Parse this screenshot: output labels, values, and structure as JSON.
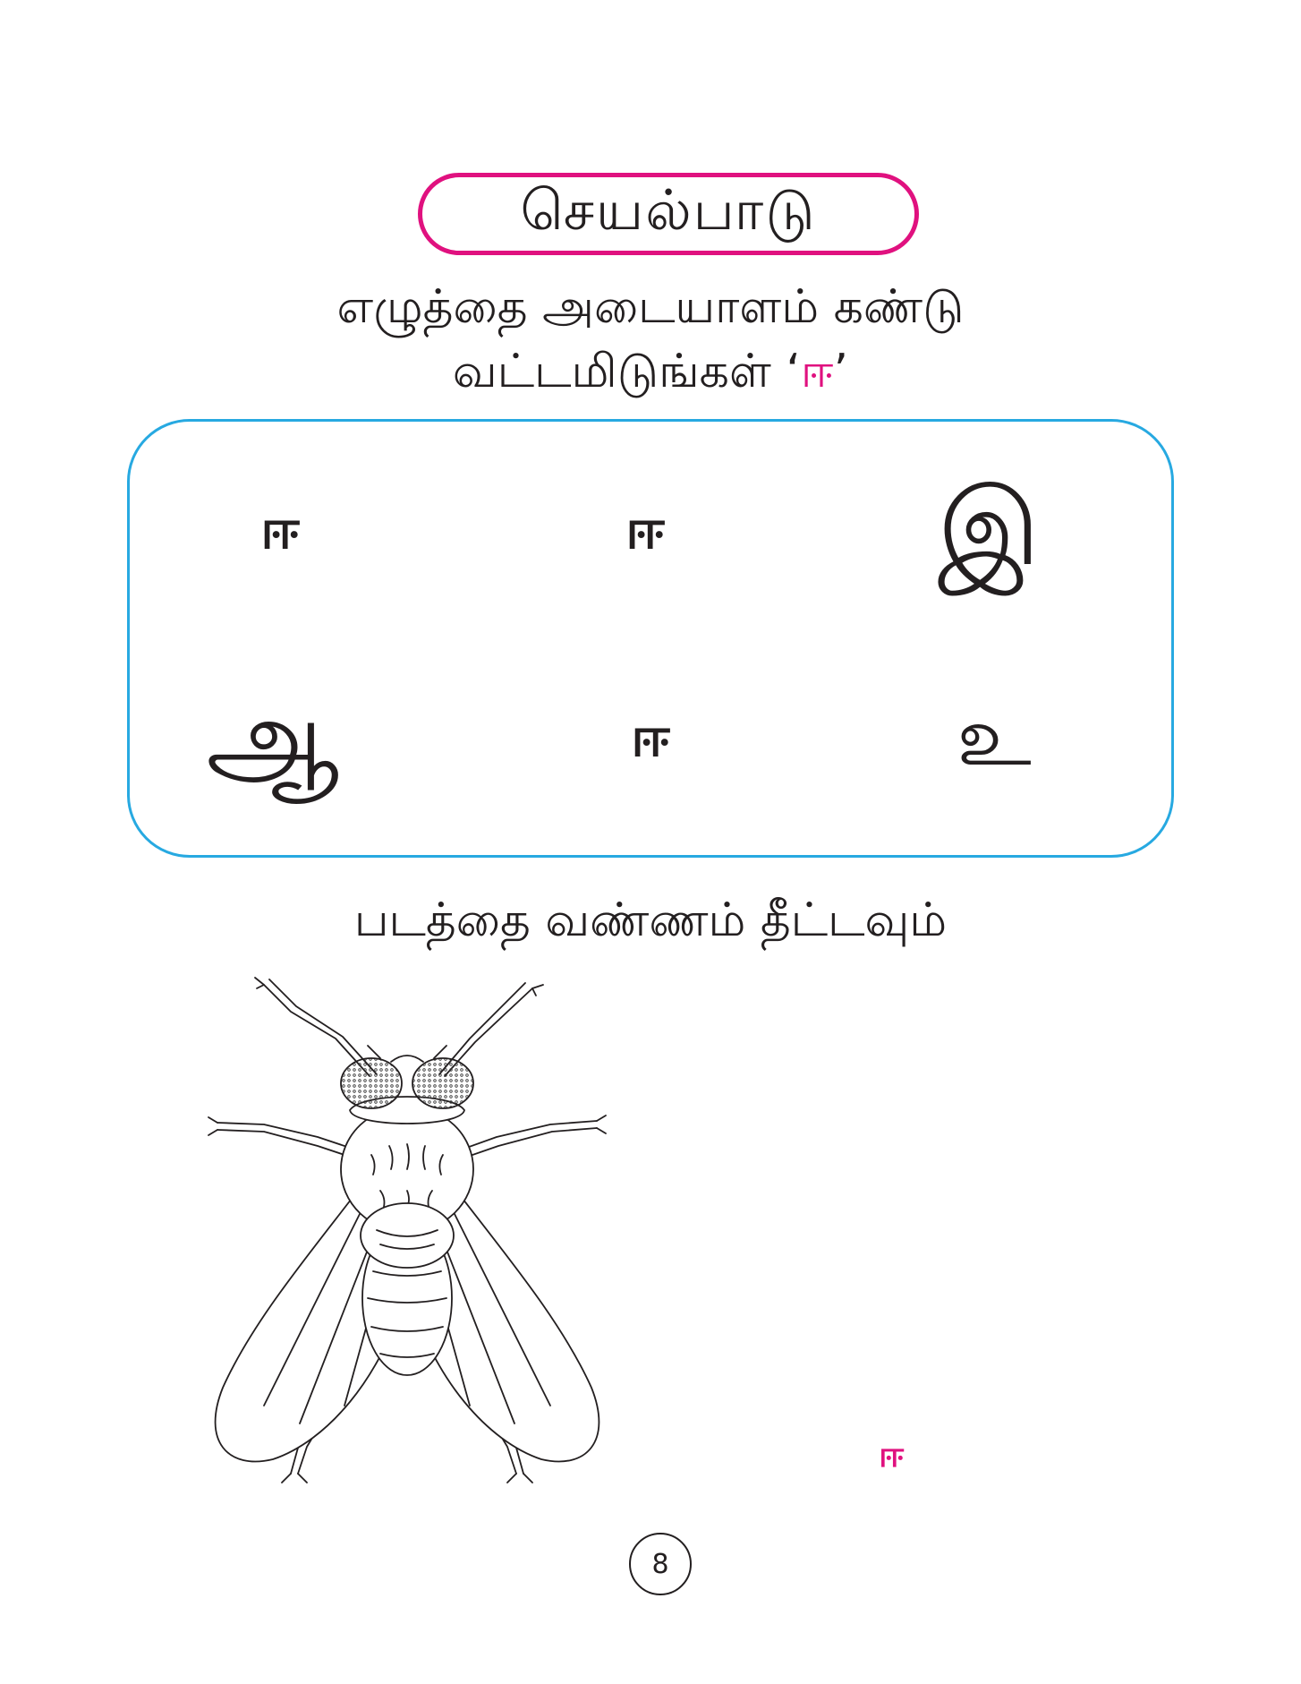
{
  "header": {
    "title": "செயல்பாடு"
  },
  "instruction": {
    "line1": "எழுத்தை அடையாளம் கண்டு",
    "line2_text": "வட்டமிடுங்கள் ",
    "quote_open": "‘",
    "target_letter": "ஈ",
    "quote_close": "’"
  },
  "letter_grid": {
    "letters": [
      "ஈ",
      "ஈ",
      "இ",
      "ஆ",
      "ஈ",
      "உ"
    ]
  },
  "coloring": {
    "instruction": "படத்தை வண்ணம் தீட்டவும்",
    "label": "ஈ"
  },
  "page_number": "8",
  "colors": {
    "accent_pink": "#e0117f",
    "box_blue": "#27a9e1",
    "ink": "#231f20"
  }
}
